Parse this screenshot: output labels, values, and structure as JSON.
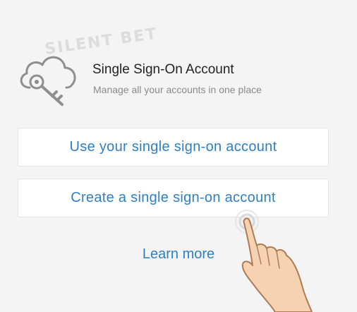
{
  "header": {
    "icon": "cloud-key-icon",
    "watermark": "SILENT BET",
    "title": "Single Sign-On Account",
    "subtitle": "Manage all your accounts in one place"
  },
  "options": {
    "use_account_label": "Use your single sign-on account",
    "create_account_label": "Create a single sign-on account"
  },
  "footer": {
    "learn_more_label": "Learn more"
  },
  "overlay": {
    "pointer_icon": "hand-pointer-icon"
  },
  "colors": {
    "background": "#f4f4f4",
    "link": "#2f7fc1",
    "title": "#222222",
    "subtitle": "#8a8a8a"
  }
}
